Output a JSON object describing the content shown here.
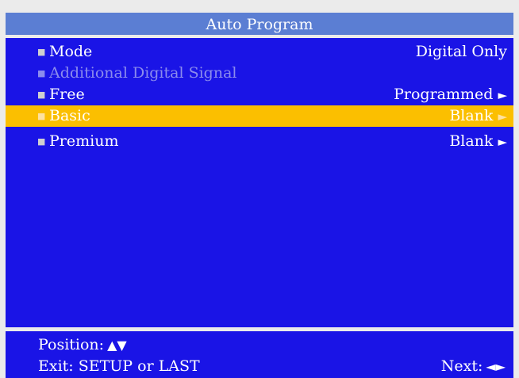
{
  "title": "Auto Program",
  "menu": {
    "rows": [
      {
        "label": "Mode",
        "value": "Digital Only",
        "arrow": ""
      },
      {
        "label": "Additional Digital Signal",
        "value": "",
        "arrow": ""
      },
      {
        "label": "Free",
        "value": "Programmed",
        "arrow": "►"
      },
      {
        "label": "Basic",
        "value": "Blank",
        "arrow": "►"
      },
      {
        "label": "Premium",
        "value": "Blank",
        "arrow": "►"
      }
    ],
    "bullet": "■",
    "selected_row": "Basic",
    "disabled_row": "Additional Digital Signal"
  },
  "footer": {
    "position_label": "Position:",
    "position_glyph": "▲▼",
    "exit_label": "Exit: SETUP or LAST",
    "next_label": "Next:",
    "next_glyph": "◄►"
  },
  "colors": {
    "panel": "#1a14e6",
    "title_bar": "#5b7ed3",
    "highlight": "#fbbf00",
    "disabled_text": "#8c8ced",
    "frame": "#ebebeb"
  }
}
